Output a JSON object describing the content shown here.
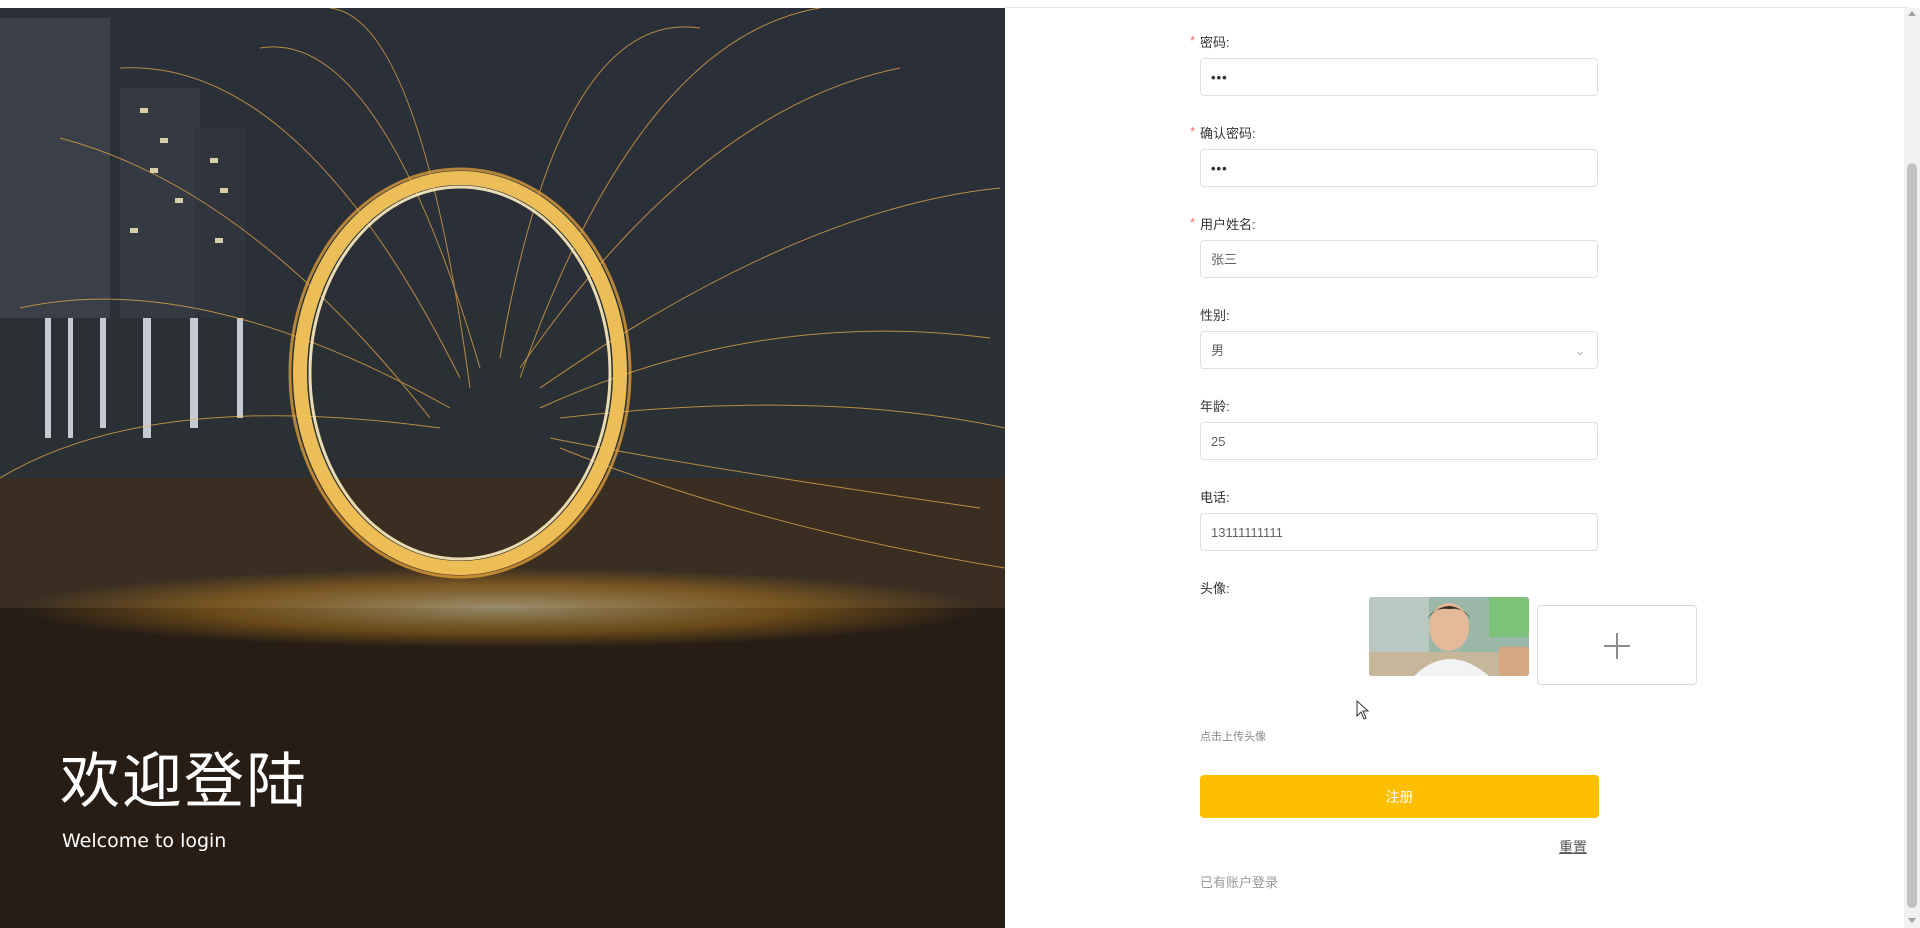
{
  "hero": {
    "title": "欢迎登陆",
    "subtitle": "Welcome to login"
  },
  "form": {
    "password": {
      "label": "密码:",
      "value": "•••"
    },
    "confirm_password": {
      "label": "确认密码:",
      "value": "•••"
    },
    "username": {
      "label": "用户姓名:",
      "value": "张三"
    },
    "gender": {
      "label": "性别:",
      "value": "男"
    },
    "age": {
      "label": "年龄:",
      "value": "25"
    },
    "phone": {
      "label": "电话:",
      "value": "13111111111"
    },
    "avatar": {
      "label": "头像:",
      "hint": "点击上传头像"
    },
    "required_mark": "*",
    "register_label": "注册",
    "reset_label": "重置",
    "login_link": "已有账户登录"
  },
  "colors": {
    "primary": "#fdbf00",
    "required": "#f56c6c",
    "border": "#dcdfe6"
  },
  "icons": {
    "upload": "plus-icon",
    "select": "chevron-down-icon"
  }
}
